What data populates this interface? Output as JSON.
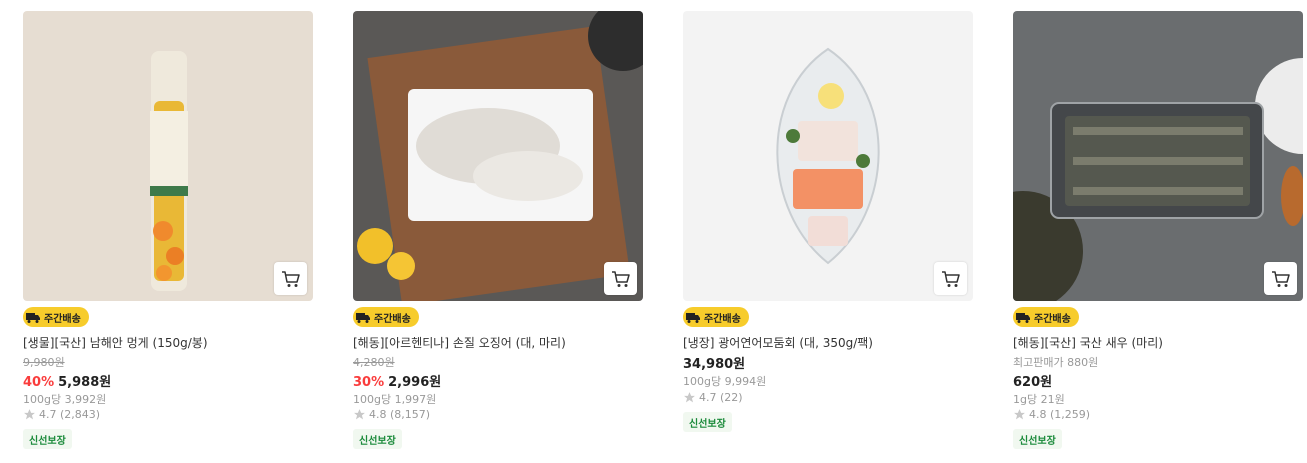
{
  "products": [
    {
      "delivery_badge": "주간배송",
      "name": "[생물][국산] 남해안 멍게 (150g/봉)",
      "original_price": "9,980원",
      "discount_rate": "40%",
      "price": "5,988원",
      "unit_price": "100g당 3,992원",
      "rating": "4.7 (2,843)",
      "tag": "신선보장"
    },
    {
      "delivery_badge": "주간배송",
      "name": "[해동][아르헨티나] 손질 오징어 (대, 마리)",
      "original_price": "4,280원",
      "discount_rate": "30%",
      "price": "2,996원",
      "unit_price": "100g당 1,997원",
      "rating": "4.8 (8,157)",
      "tag": "신선보장"
    },
    {
      "delivery_badge": "주간배송",
      "name": "[냉장] 광어연어모둠회 (대, 350g/팩)",
      "price": "34,980원",
      "unit_price": "100g당 9,994원",
      "rating": "4.7 (22)",
      "tag": "신선보장"
    },
    {
      "delivery_badge": "주간배송",
      "name": "[해동][국산] 국산 새우 (마리)",
      "lowest_price_note": "최고판매가 880원",
      "price": "620원",
      "unit_price": "1g당 21원",
      "rating": "4.8 (1,259)",
      "tag": "신선보장"
    }
  ],
  "colors": {
    "discount": "#fa3c3c",
    "badge_bg": "#f7cc2b",
    "tag_text": "#1a8a3a",
    "tag_bg": "#f1f8f0"
  }
}
